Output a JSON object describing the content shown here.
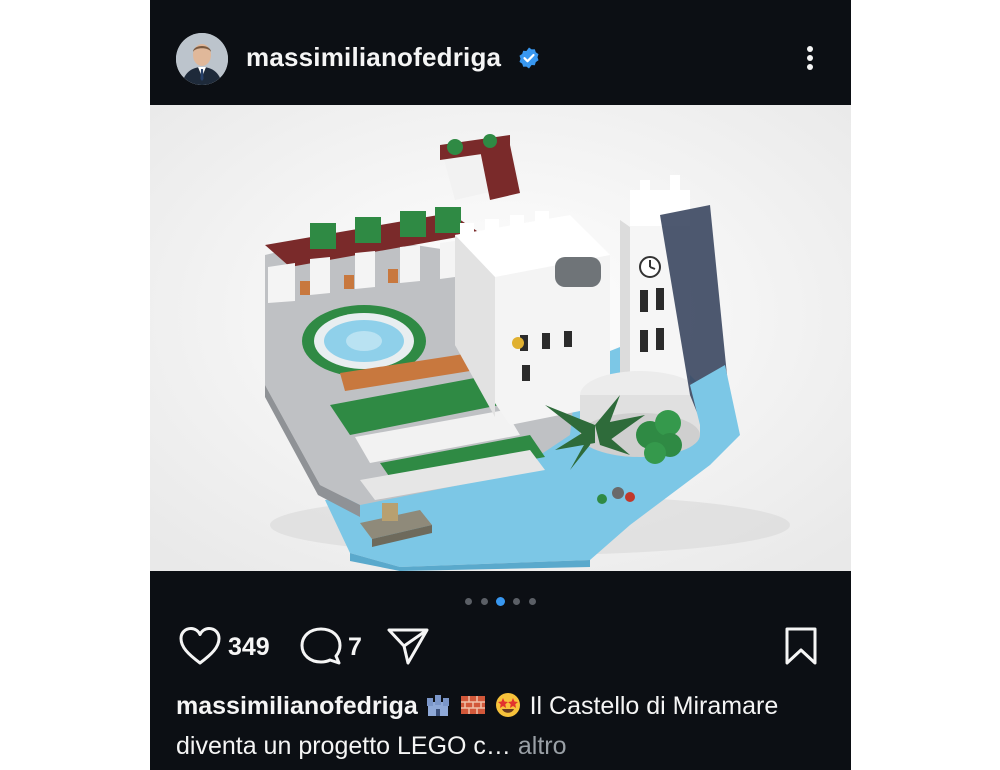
{
  "post": {
    "username": "massimilianofedriga",
    "verified": true,
    "header_icons": {
      "avatar": "profile-photo",
      "verified": "verified-badge-icon",
      "menu": "more-options-icon"
    },
    "image": {
      "description_icon": "lego-castle-photo",
      "carousel_count": 5,
      "carousel_active_index": 2
    },
    "actions": {
      "like_icon": "heart-icon",
      "like_count": "349",
      "comment_icon": "comment-icon",
      "comment_count": "7",
      "share_icon": "send-icon",
      "save_icon": "bookmark-icon"
    },
    "caption": {
      "username": "massimilianofedriga",
      "emojis": [
        "castle-emoji",
        "brick-emoji",
        "star-struck-emoji"
      ],
      "text": "Il Castello di Miramare diventa un progetto LEGO c…",
      "more_label": "altro"
    }
  },
  "colors": {
    "background": "#0c0f14",
    "text": "#f5f5f5",
    "accent": "#3897f0",
    "muted": "#9aa0a6"
  }
}
